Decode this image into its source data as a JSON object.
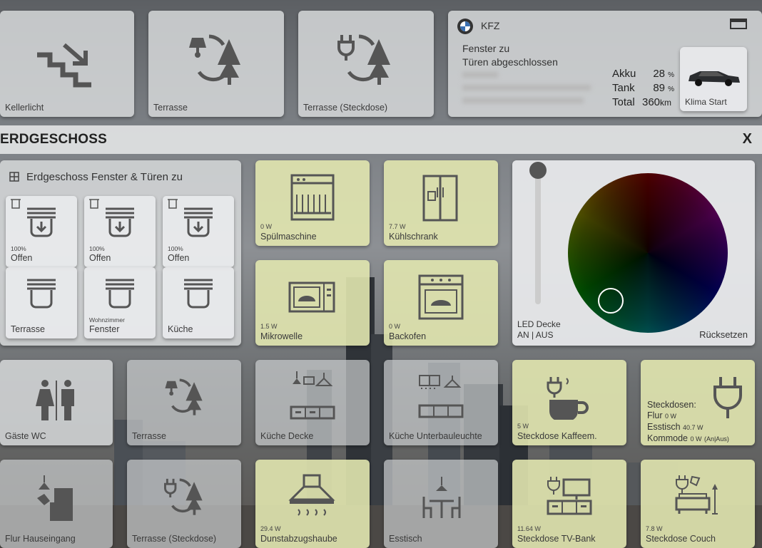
{
  "top_row": {
    "kellerlicht": "Kellerlicht",
    "terrasse": "Terrasse",
    "terrasse_steckdose": "Terrasse (Steckdose)"
  },
  "kfz": {
    "title": "KFZ",
    "line1": "Fenster zu",
    "line2": "Türen abgeschlossen",
    "akku_label": "Akku",
    "akku_value": "28",
    "akku_unit": "%",
    "tank_label": "Tank",
    "tank_value": "89",
    "tank_unit": "%",
    "total_label": "Total",
    "total_value": "360",
    "total_unit": "km",
    "climate_button": "Klima Start"
  },
  "section": {
    "title": "ERDGESCHOSS",
    "close": "X"
  },
  "windows": {
    "title": "Erdgeschoss Fenster & Türen zu",
    "items": [
      {
        "pct": "100%",
        "label": "Offen"
      },
      {
        "pct": "100%",
        "label": "Offen"
      },
      {
        "pct": "100%",
        "label": "Offen"
      },
      {
        "pct": "",
        "label": "Terrasse"
      },
      {
        "pct": "Wohnzimmer",
        "label": "Fenster"
      },
      {
        "pct": "",
        "label": "Küche"
      }
    ]
  },
  "appliances": [
    {
      "value": "0 W",
      "label": "Spülmaschine"
    },
    {
      "value": "7.7 W",
      "label": "Kühlschrank"
    },
    {
      "value": "1.5 W",
      "label": "Mikrowelle"
    },
    {
      "value": "0 W",
      "label": "Backofen"
    }
  ],
  "led": {
    "title": "LED Decke",
    "toggle": "AN | AUS",
    "reset": "Rücksetzen"
  },
  "row3": {
    "gaeste_wc": "Gäste WC",
    "terrasse": "Terrasse",
    "kueche_decke": "Küche Decke",
    "kueche_unterbau": "Küche Unterbauleuchte",
    "kaffee_value": "5 W",
    "kaffee_label": "Steckdose Kaffeem."
  },
  "steckdosen": {
    "title": "Steckdosen:",
    "flur_label": "Flur",
    "flur_value": "0 W",
    "esstisch_label": "Esstisch",
    "esstisch_value": "40.7 W",
    "kommode_label": "Kommode",
    "kommode_value": "0 W",
    "kommode_toggle": "(An|Aus)"
  },
  "row4": {
    "flur": "Flur Hauseingang",
    "terrasse_steckdose": "Terrasse (Steckdose)",
    "dunst_value": "29.4 W",
    "dunst_label": "Dunstabzugshaube",
    "esstisch": "Esstisch",
    "tv_value": "11.64 W",
    "tv_label": "Steckdose TV-Bank",
    "couch_value": "7.8 W",
    "couch_label": "Steckdose Couch"
  },
  "colors": {
    "yellow_tile": "#e1e6af",
    "grey_tile": "#d5d7d9",
    "icon": "#555555"
  }
}
